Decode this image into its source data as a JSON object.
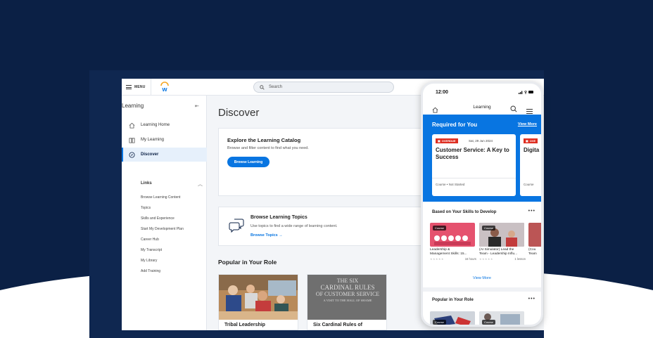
{
  "colors": {
    "background": "#0b2045",
    "accent": "#0875e1",
    "overdue": "#de2e21"
  },
  "topbar": {
    "menu_label": "MENU",
    "search_placeholder": "Search",
    "logo_icon": "workday-logo"
  },
  "sidebar": {
    "title": "Learning",
    "items": [
      {
        "label": "Learning Home",
        "icon": "home-icon"
      },
      {
        "label": "My Learning",
        "icon": "book-icon"
      },
      {
        "label": "Discover",
        "icon": "compass-icon",
        "active": true
      }
    ],
    "links_header": "Links",
    "links": [
      "Browse Learning Content",
      "Topics",
      "Skills and Experience",
      "Start My Development Plan",
      "Career Hub",
      "My Transcript",
      "My Library",
      "Add Training"
    ]
  },
  "main": {
    "title": "Discover",
    "catalog": {
      "heading": "Explore the Learning Catalog",
      "description": "Browse and filter content to find what you need.",
      "button": "Browse Learning"
    },
    "topics": {
      "heading": "Browse Learning Topics",
      "description": "Use topics to find a wide range of learning content.",
      "link": "Browse Topics →"
    },
    "popular_heading": "Popular in Your Role",
    "courses": [
      {
        "title": "Tribal Leadership"
      },
      {
        "title": "Six Cardinal Rules of",
        "image_text": [
          "THE SIX",
          "CARDINAL RULES",
          "OF CUSTOMER SERVICE",
          "A VISIT TO THE HALL OF SHAME"
        ]
      }
    ]
  },
  "phone": {
    "time": "12:00",
    "nav_title": "Learning",
    "required": {
      "heading": "Required for You",
      "view_more": "View More",
      "cards": [
        {
          "badge": "OVERDUE",
          "date": "Sat, 29 Jun 2024",
          "title": "Customer Service: A Key to Success",
          "status": "Course • Not Started"
        },
        {
          "badge": "OVE",
          "title": "Digita",
          "status": "Course"
        }
      ]
    },
    "skills": {
      "heading": "Based on Your Skills to Develop",
      "more": "•••",
      "cards": [
        {
          "tag": "Course",
          "title1": "Leadership &",
          "title2": "Management Skills: 15...",
          "duration": "16 hours"
        },
        {
          "tag": "Course",
          "title1": "(AI Simulator) Lead the",
          "title2": "Team - Leadership Influ...",
          "duration": "1 lesson"
        },
        {
          "tag": "",
          "title1": "(Cou",
          "title2": "Team",
          "duration": ""
        }
      ],
      "view_more": "View More"
    },
    "popular": {
      "heading": "Popular in Your Role",
      "more": "•••",
      "tags": [
        "Course",
        "Course"
      ]
    }
  }
}
